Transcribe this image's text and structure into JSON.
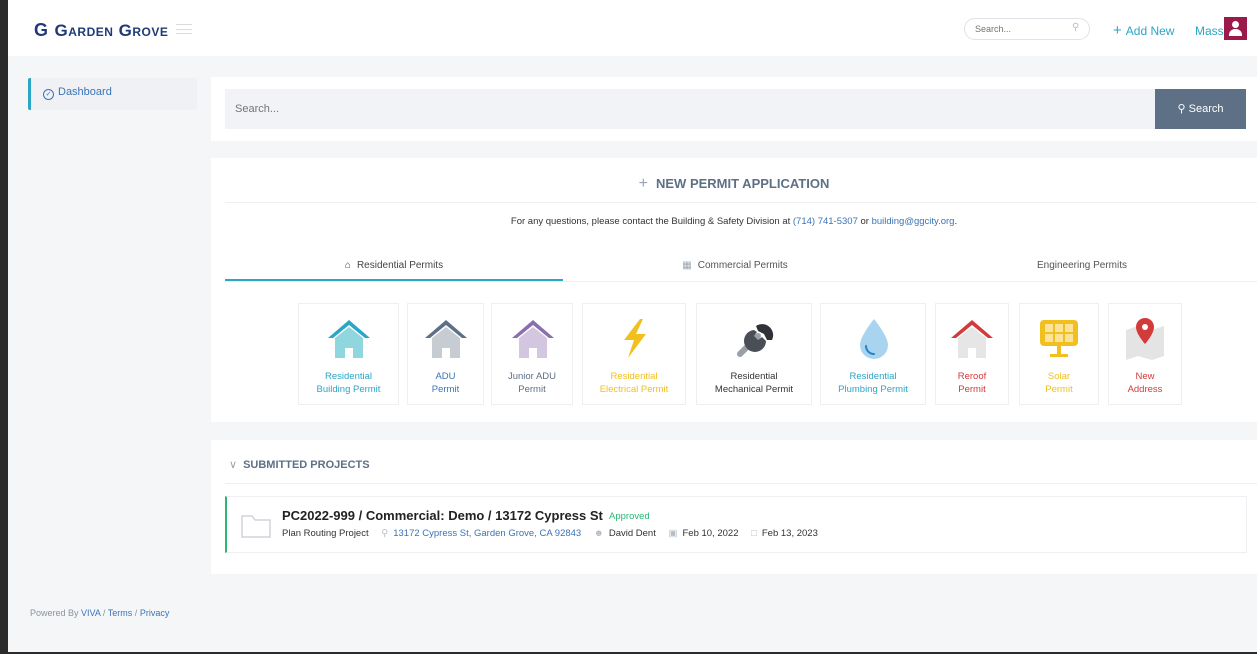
{
  "header": {
    "logo_mark": "G",
    "logo_text": "Garden Grove",
    "search_placeholder": "Search...",
    "add_new_label": "Add New",
    "user_name": "Mass"
  },
  "sidebar": {
    "items": [
      {
        "label": "Dashboard",
        "icon": "dashboard-gauge-icon"
      }
    ]
  },
  "footer": {
    "powered_by": "Powered By",
    "brand": "VIVA",
    "terms": "Terms",
    "privacy": "Privacy",
    "separator": "/"
  },
  "search": {
    "placeholder": "Search...",
    "button_label": "Search"
  },
  "permit_panel": {
    "title": "NEW PERMIT APPLICATION",
    "contact_text": "For any questions, please contact the Building & Safety Division at",
    "phone": "(714) 741-5307",
    "or": "or",
    "email": "building@ggcity.org",
    "period": ".",
    "tabs": [
      {
        "label": "Residential Permits",
        "icon": "house-icon",
        "active": true
      },
      {
        "label": "Commercial Permits",
        "icon": "building-icon",
        "active": false
      },
      {
        "label": "Engineering Permits",
        "icon": "",
        "active": false
      }
    ],
    "cards": [
      {
        "line1": "Residential",
        "line2": "Building Permit",
        "color": "#2aa6c6",
        "icon": "house-teal-icon"
      },
      {
        "line1": "ADU",
        "line2": "Permit",
        "color": "#3a74b8",
        "icon": "house-gray-icon"
      },
      {
        "line1": "Junior ADU",
        "line2": "Permit",
        "color": "#5d7086",
        "icon": "house-purple-icon"
      },
      {
        "line1": "Residential",
        "line2": "Electrical Permit",
        "color": "#f2c01e",
        "icon": "lightning-icon"
      },
      {
        "line1": "Residential",
        "line2": "Mechanical Permit",
        "color": "#333333",
        "icon": "wrench-icon"
      },
      {
        "line1": "Residential",
        "line2": "Plumbing Permit",
        "color": "#2aa6c6",
        "icon": "water-drop-icon"
      },
      {
        "line1": "Reroof",
        "line2": "Permit",
        "color": "#d33a3a",
        "icon": "roof-red-icon"
      },
      {
        "line1": "Solar",
        "line2": "Permit",
        "color": "#f2c01e",
        "icon": "solar-panel-icon"
      },
      {
        "line1": "New",
        "line2": "Address",
        "color": "#d33a3a",
        "icon": "map-pin-icon"
      }
    ]
  },
  "submitted": {
    "title": "SUBMITTED PROJECTS",
    "projects": [
      {
        "title": "PC2022-999 / Commercial: Demo / 13172 Cypress St",
        "status": "Approved",
        "type": "Plan Routing Project",
        "address": "13172 Cypress St, Garden Grove, CA 92843",
        "person": "David Dent",
        "date_start": "Feb 10, 2022",
        "date_end": "Feb 13, 2023"
      }
    ]
  },
  "colors": {
    "accent": "#2aa6c6",
    "link": "#3a74b8",
    "brand": "#1e3a78",
    "approved": "#2bb673",
    "search_button": "#5d7086",
    "avatar": "#9b1a4b"
  }
}
